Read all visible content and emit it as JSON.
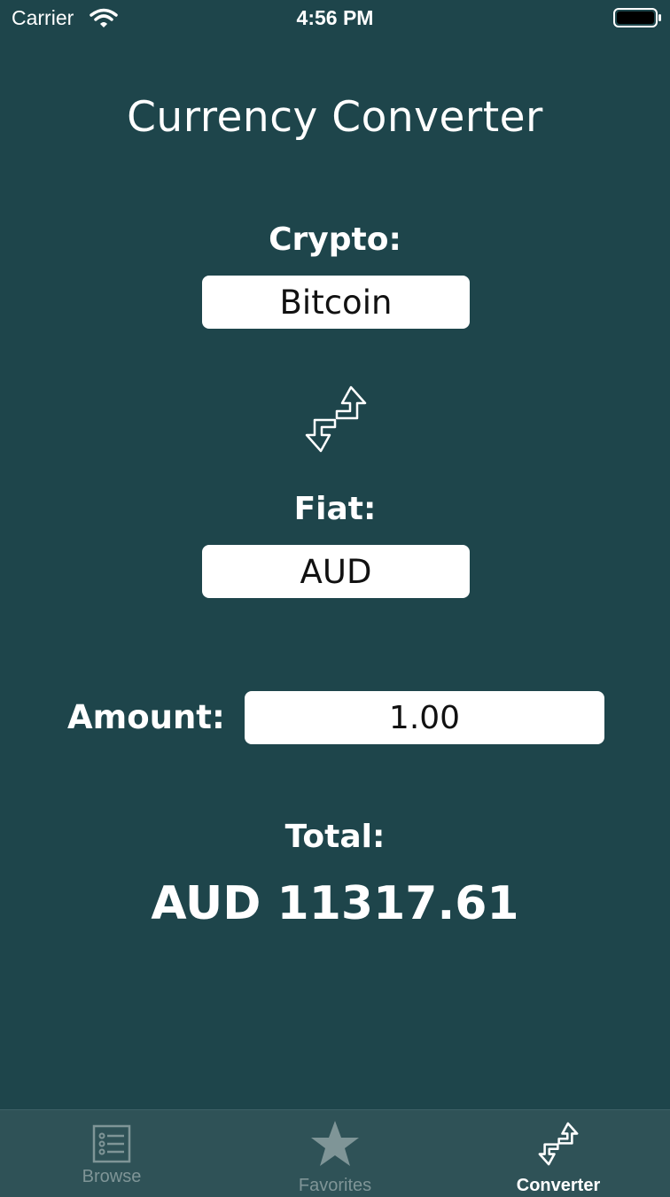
{
  "status_bar": {
    "carrier": "Carrier",
    "time": "4:56 PM"
  },
  "title": "Currency Converter",
  "crypto": {
    "label": "Crypto:",
    "value": "Bitcoin"
  },
  "swap_icon": "swap-arrows-icon",
  "fiat": {
    "label": "Fiat:",
    "value": "AUD"
  },
  "amount": {
    "label": "Amount:",
    "value": "1.00"
  },
  "total": {
    "label": "Total:",
    "value": "AUD 11317.61"
  },
  "tab_bar": {
    "tabs": [
      {
        "label": "Browse",
        "icon": "list-icon",
        "active": false
      },
      {
        "label": "Favorites",
        "icon": "star-icon",
        "active": false
      },
      {
        "label": "Converter",
        "icon": "swap-arrows-icon",
        "active": true
      }
    ]
  },
  "colors": {
    "background": "#1e454b",
    "tab_bar": "#2f5257",
    "tab_inactive": "#7f9597",
    "tab_active": "#ffffff"
  }
}
